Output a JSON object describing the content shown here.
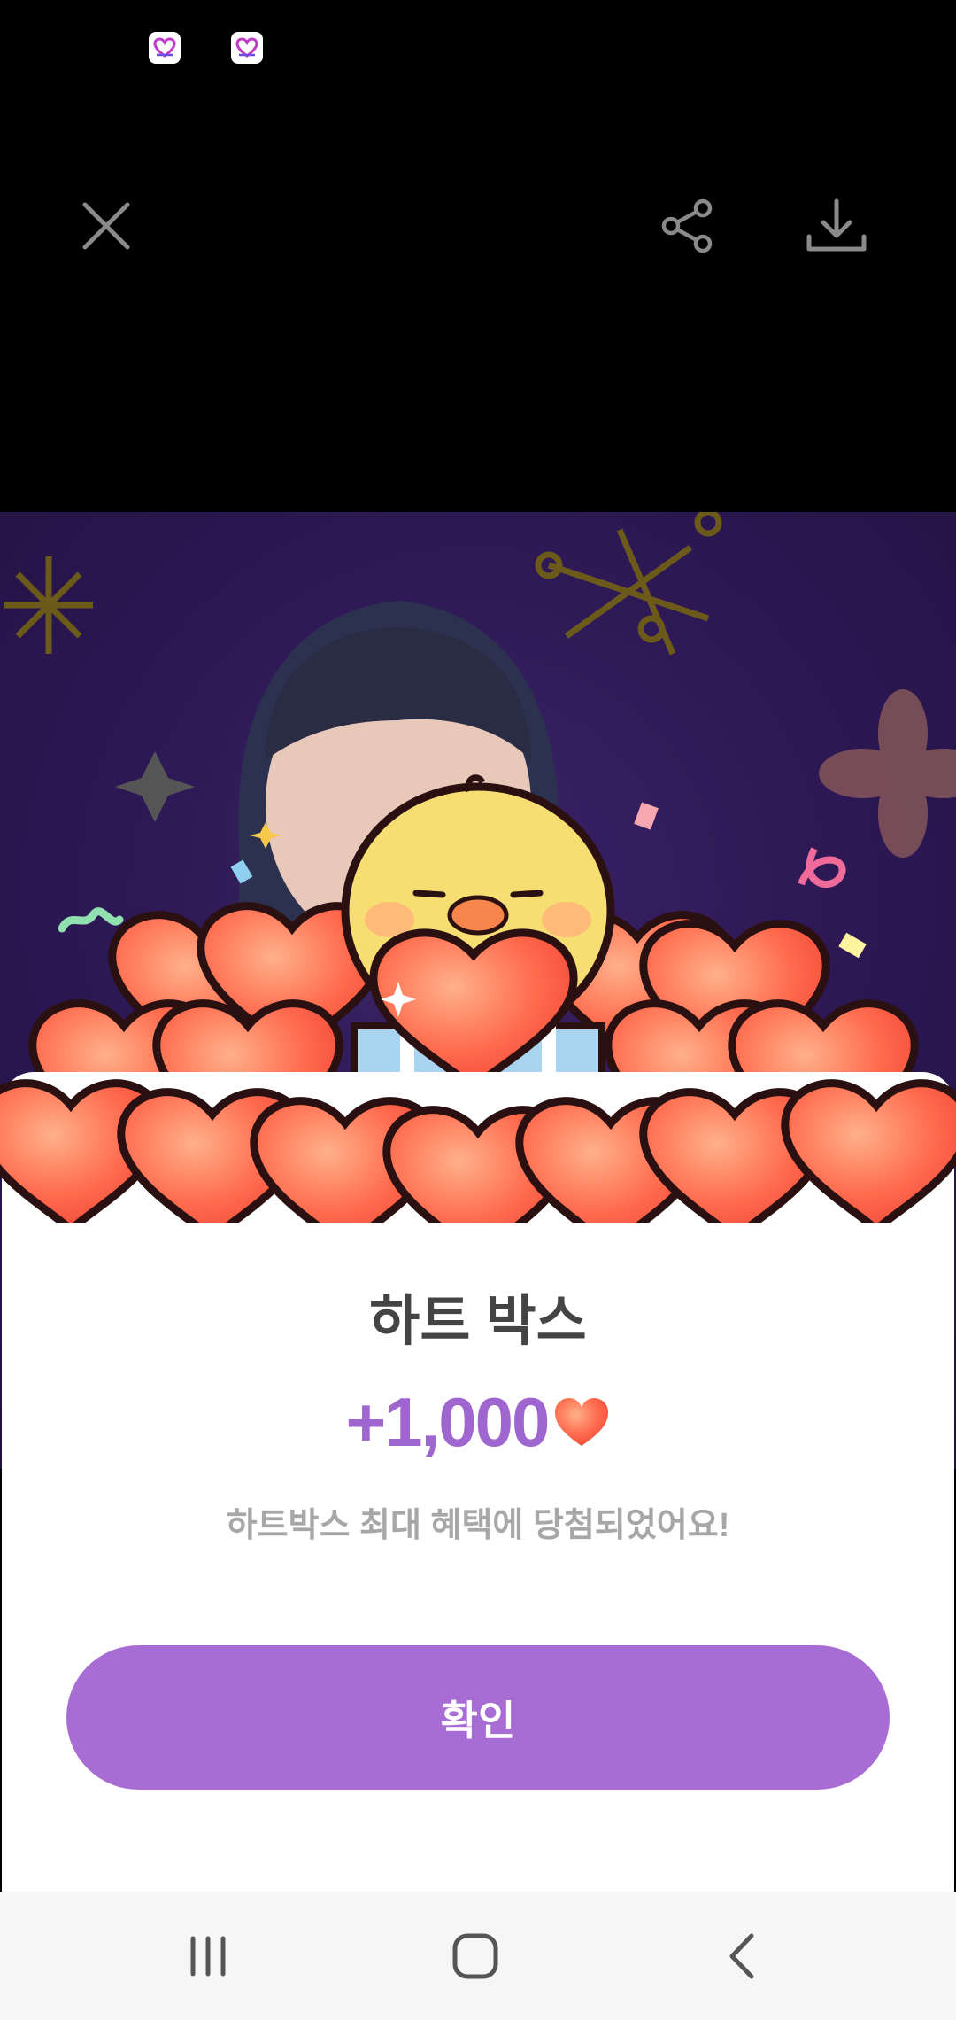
{
  "status_bar": {
    "notification_icons": [
      "heart-app-icon",
      "heart-app-icon"
    ]
  },
  "toolbar": {
    "close_icon": "close-icon",
    "share_icon": "share-icon",
    "download_icon": "download-icon"
  },
  "image": {
    "description_icon": "chick-holding-heart-illustration"
  },
  "dialog": {
    "title": "하트 박스",
    "reward_amount": "+1,000",
    "reward_icon": "heart-icon",
    "message": "하트박스 최대 혜택에 당첨되었어요!",
    "confirm_label": "확인"
  },
  "colors": {
    "accent": "#a86cd5",
    "reward_text": "#a066d0",
    "heart": "#ff6a4d",
    "background_purple": "#2b1752"
  },
  "nav_bar": {
    "recents_icon": "recents-icon",
    "home_icon": "home-icon",
    "back_icon": "back-icon"
  }
}
